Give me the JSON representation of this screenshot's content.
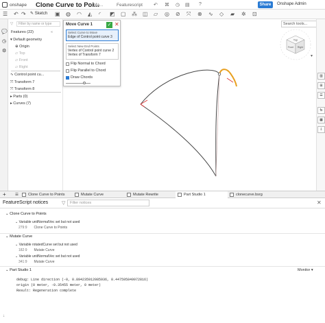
{
  "app": {
    "brand": "onshape",
    "doc_title": "Clone Curve to Poi...",
    "main_label": "Ma...",
    "featurescript_label": "Featurescript",
    "share": "Share",
    "user": "Onshape Admin"
  },
  "toolbar": {
    "sketch": "Sketch",
    "search_placeholder": "Search tools..."
  },
  "features": {
    "filter_placeholder": "Filter by name or type",
    "header": "Features (22)",
    "default_geometry": "Default geometry",
    "items_default": [
      "Origin",
      "Top",
      "Front",
      "Right"
    ],
    "cp": "Control point cu...",
    "t7": "Transform 7",
    "t8": "Transform 8",
    "parts": "Parts (0)",
    "curves": "Curves (7)"
  },
  "dialog": {
    "title": "Move Curve 1",
    "sel_caption": "Select Curve to Move",
    "sel_value": "Edge of Control point curve 3",
    "end_caption": "Select New End Points",
    "end_1": "Vertex of Control point curve 2",
    "end_2": "Vertex of Transform 7",
    "opt_1": "Flip Normal to Chord",
    "opt_2": "Flip Parallel to Chord",
    "opt_3": "Draw Chords"
  },
  "viewcube": {
    "top": "Top",
    "front": "Front",
    "right": "Right"
  },
  "tabs": [
    "Clone Curve to Points",
    "Mutate Curve",
    "Mutate Rewrite",
    "Part Studio 1",
    "clonecurve.bsrg"
  ],
  "notices": {
    "title": "FeatureScript notices",
    "filter_placeholder": "Filter notices",
    "sections": [
      {
        "name": "Clone Curve to Points",
        "items": [
          {
            "msg": "Variable unitNormalVec set but not used",
            "line": "279:9",
            "src": "Clone Curve to Points"
          }
        ]
      },
      {
        "name": "Mutate Curve",
        "items": [
          {
            "msg": "Variable rotatedCurve set but not used",
            "line": "182:9",
            "src": "Mutate Curve"
          },
          {
            "msg": "Variable unitNormalVec set but not used",
            "line": "341:9",
            "src": "Mutate Curve"
          }
        ]
      }
    ],
    "part_studio": "Part Studio 1",
    "monitor": "Monitor",
    "console": [
      "debug: Line direction (-0, 0.894235912085936, 0.447595849972816)",
      "origin (0 meter, -0.35455 meter, 0 meter)",
      "  Result: Regeneration complete"
    ]
  },
  "colors": {
    "accent": "#2a7bd4",
    "highlight": "#e8a020",
    "ok": "#39a845"
  }
}
